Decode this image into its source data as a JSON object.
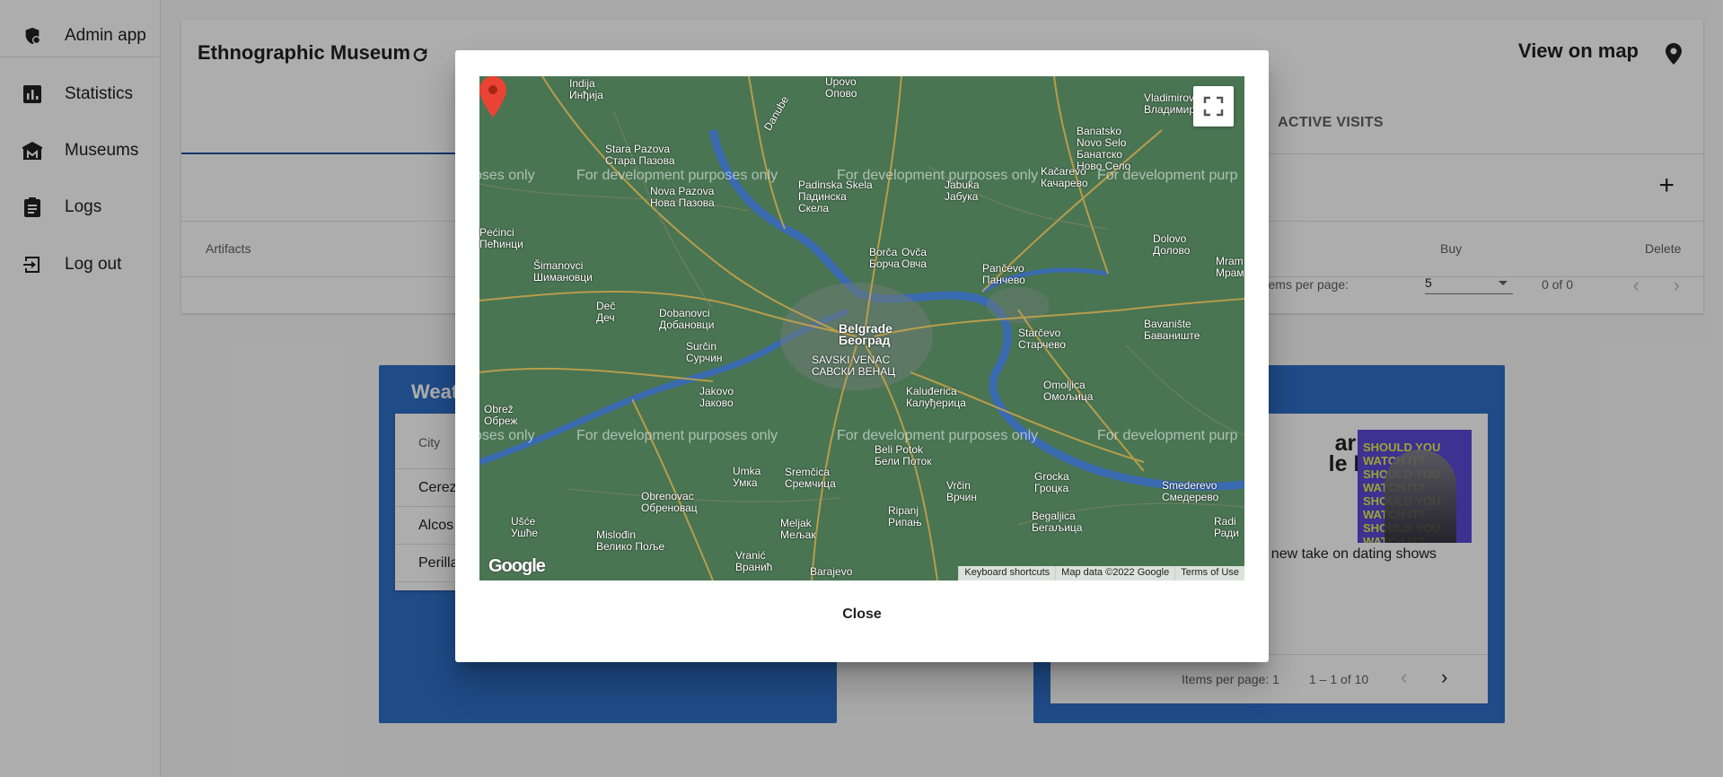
{
  "sidebar": {
    "items": [
      {
        "label": "Admin app",
        "icon": "admin-shield-icon"
      },
      {
        "label": "Statistics",
        "icon": "bar-chart-icon"
      },
      {
        "label": "Museums",
        "icon": "museum-icon"
      },
      {
        "label": "Logs",
        "icon": "clipboard-icon"
      },
      {
        "label": "Log out",
        "icon": "logout-icon"
      }
    ]
  },
  "header": {
    "museum_name": "Ethnographic Museum",
    "view_on_map": "View on map"
  },
  "tabs": [
    {
      "label": "ACTIVE VISITS"
    }
  ],
  "table": {
    "columns": {
      "artifacts": "Artifacts",
      "buy": "Buy",
      "delete": "Delete"
    },
    "add_label": "+"
  },
  "paginator": {
    "items_per_page_label": "Items per page:",
    "page_size": "5",
    "range": "0 of 0"
  },
  "weather": {
    "title": "Weat",
    "column_city": "City",
    "rows": [
      "Cerez",
      "Alcos",
      "Perilla"
    ]
  },
  "news": {
    "title_line1": "arry Or",
    "title_line2": "le Mess",
    "thumb_text": "SHOULD YOU WATCH IT? SHOULD YOU WATCH IT? SHOULD YOU WATCH IT? SHOULD YOU WATCH IT? SHOULD YOU WATCH IT?",
    "description": "s a new take on dating shows",
    "items_per_page": "Items per page: 1",
    "range": "1 – 1 of 10"
  },
  "dialog": {
    "close_label": "Close",
    "map": {
      "dev_watermark": "For development purposes only",
      "dev_watermark_partial_left": "oses only",
      "dev_watermark_partial_right": "For development purp",
      "google_logo": "Google",
      "attribution": [
        "Keyboard shortcuts",
        "Map data ©2022 Google",
        "Terms of Use"
      ],
      "labels": [
        {
          "t": "Indija\nИнђија"
        },
        {
          "t": "Upovo\nОпово"
        },
        {
          "t": "Vladimirovac\nВладимировац"
        },
        {
          "t": "Stara Pazova\nСтара Пазова"
        },
        {
          "t": "Padinska Skela\nПадинска\nСкела"
        },
        {
          "t": "Jabuka\nЈабука"
        },
        {
          "t": "Kačarevo\nКачарево"
        },
        {
          "t": "Banatsko\nNovo Selo\nБанатско\nНово Село"
        },
        {
          "t": "Nova Pazova\nНова Пазова"
        },
        {
          "t": "Pećinci\nПећинци"
        },
        {
          "t": "Borča\nБорча"
        },
        {
          "t": "Ovča\nОвча"
        },
        {
          "t": "Dolovo\nДолово"
        },
        {
          "t": "Šimanovci\nШимановци"
        },
        {
          "t": "Pančevo\nПанчево"
        },
        {
          "t": "Mram\nМрам"
        },
        {
          "t": "Deč\nДеч"
        },
        {
          "t": "Dobanovci\nДобановци"
        },
        {
          "t": "Belgrade\nБеоград",
          "big": true
        },
        {
          "t": "Starčevo\nСтарчево"
        },
        {
          "t": "Bavanište\nБаваниште"
        },
        {
          "t": "Surčin\nСурчин"
        },
        {
          "t": "SAVSKI VENAC\nСАВСКИ ВЕНАЦ"
        },
        {
          "t": "Jakovo\nЈаково"
        },
        {
          "t": "Kaluđerica\nКалуђерица"
        },
        {
          "t": "Omoljica\nОмољица"
        },
        {
          "t": "Obrež\nОбреж"
        },
        {
          "t": "Beli Potok\nБели Поток"
        },
        {
          "t": "Umka\nУмка"
        },
        {
          "t": "Sremčica\nСремчица"
        },
        {
          "t": "Vrčin\nВрчин"
        },
        {
          "t": "Grocka\nГроцка"
        },
        {
          "t": "Smederevo\nСмедерево"
        },
        {
          "t": "Obrenovac\nОбреновац"
        },
        {
          "t": "Ripanj\nРипањ"
        },
        {
          "t": "Begaljica\nБегаљица"
        },
        {
          "t": "Ušće\nУшће"
        },
        {
          "t": "Mislođin\nВелико Поље"
        },
        {
          "t": "Meljak\nМељак"
        },
        {
          "t": "Vranić\nВранић"
        },
        {
          "t": "Barajevo"
        },
        {
          "t": "Radi\nРади"
        },
        {
          "t": "Danube"
        }
      ]
    }
  },
  "colors": {
    "accent": "#1e4f9c",
    "card_blue": "#2f6fc7",
    "map_green": "#4a7553",
    "pin_red": "#ea4335"
  }
}
